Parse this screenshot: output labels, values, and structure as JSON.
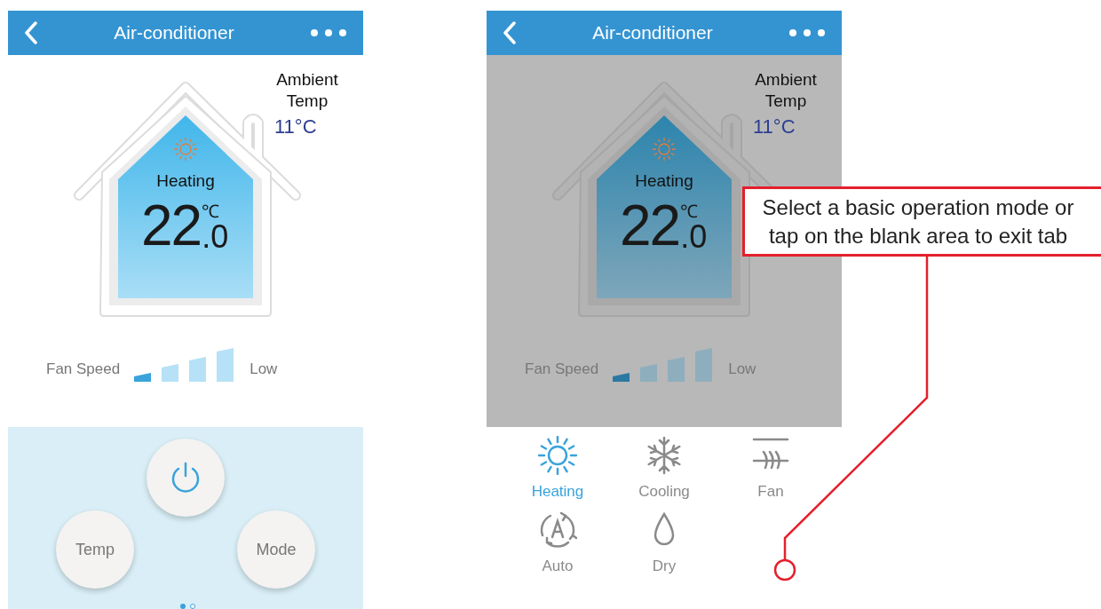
{
  "screens": [
    {
      "title": "Air-conditioner",
      "overlay": false,
      "ambient": {
        "label": "Ambient Temp",
        "value": "11°C"
      },
      "mode": "Heating",
      "temperature": {
        "whole": "22",
        "decimal": ".0",
        "unit": "℃"
      },
      "fan_speed": {
        "label": "Fan Speed",
        "level": 0.25,
        "value": "Low"
      },
      "bottom": {
        "kind": "controls",
        "buttons": [
          {
            "kind": "power"
          },
          {
            "kind": "text",
            "label": "Temp"
          },
          {
            "kind": "text",
            "label": "Mode"
          }
        ],
        "page_dots": [
          {
            "selected": true
          },
          {
            "selected": false
          }
        ]
      }
    },
    {
      "title": "Air-conditioner",
      "overlay": true,
      "ambient": {
        "label": "Ambient Temp",
        "value": "11°C"
      },
      "mode": "Heating",
      "temperature": {
        "whole": "22",
        "decimal": ".0",
        "unit": "℃"
      },
      "fan_speed": {
        "label": "Fan Speed",
        "level": 0.25,
        "value": "Low"
      },
      "bottom": {
        "kind": "modes",
        "modes": [
          {
            "kind": "heating",
            "label": "Heating",
            "selected": true
          },
          {
            "kind": "cooling",
            "label": "Cooling",
            "selected": false
          },
          {
            "kind": "fan",
            "label": "Fan",
            "selected": false
          },
          {
            "kind": "auto",
            "label": "Auto",
            "selected": false
          },
          {
            "kind": "dry",
            "label": "Dry",
            "selected": false
          }
        ]
      }
    }
  ],
  "callout": {
    "text": "Select a basic operation mode or tap on the blank area to exit tab"
  }
}
